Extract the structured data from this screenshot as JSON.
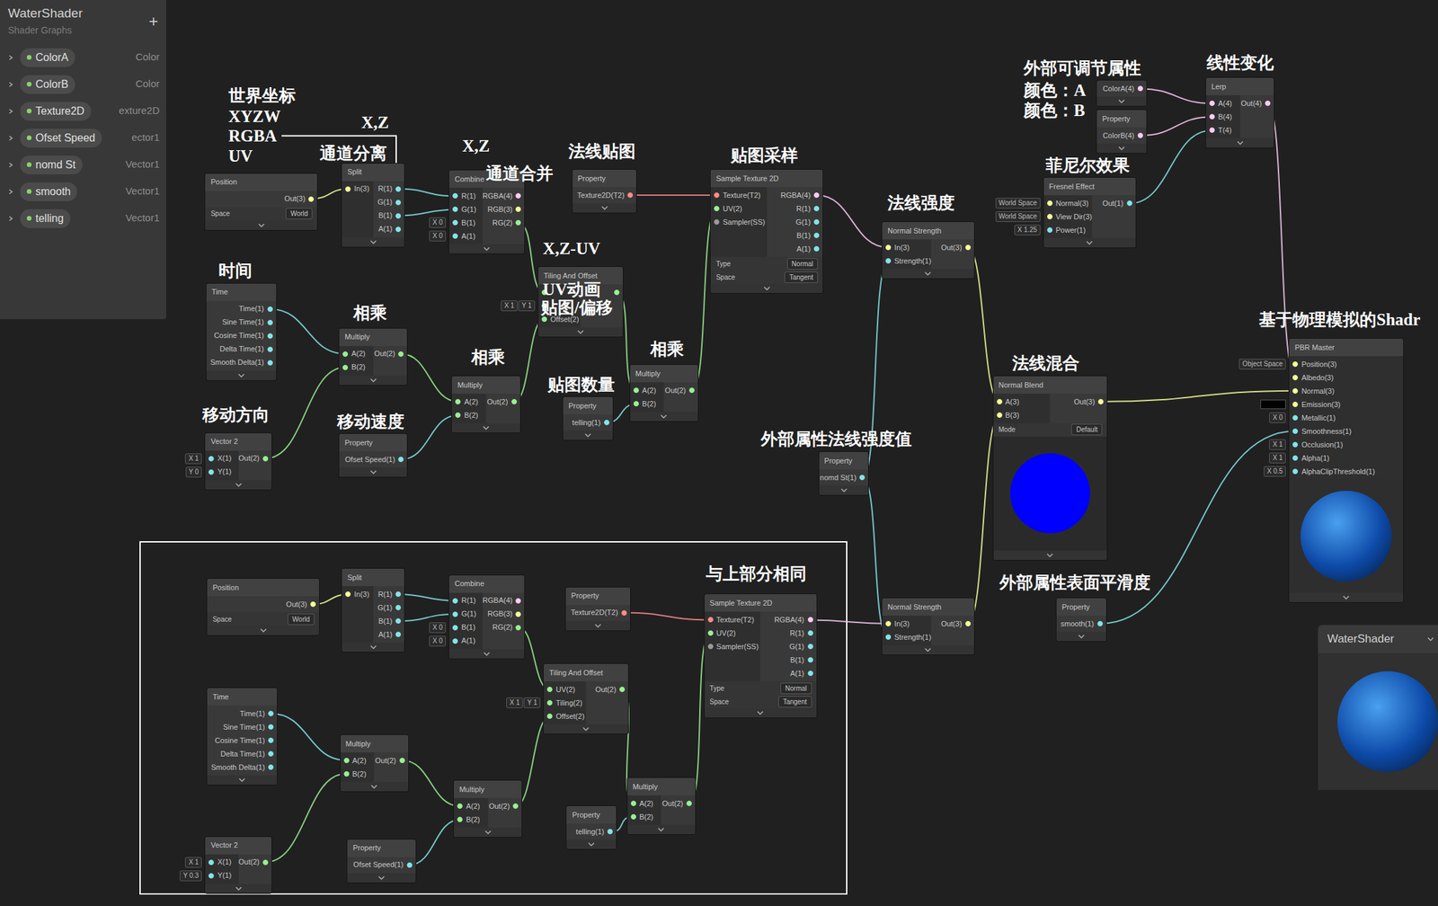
{
  "blackboard": {
    "title": "WaterShader",
    "subtitle": "Shader Graphs",
    "add": "+",
    "properties": [
      {
        "name": "ColorA",
        "type": "Color",
        "expanded": false
      },
      {
        "name": "ColorB",
        "type": "Color",
        "expanded": false
      },
      {
        "name": "Texture2D",
        "type": "exture2D",
        "expanded": false
      },
      {
        "name": "Ofset Speed",
        "type": "ector1",
        "expanded": false
      },
      {
        "name": "nomd St",
        "type": "Vector1",
        "expanded": false
      },
      {
        "name": "smooth",
        "type": "Vector1",
        "expanded": false
      },
      {
        "name": "telling",
        "type": "Vector1",
        "expanded": false
      }
    ]
  },
  "nodes": [
    {
      "title": "Position",
      "inputs": [],
      "outputs": [
        {
          "label": "Out(3)"
        }
      ],
      "fields": [
        {
          "label": "Space",
          "value": "World"
        }
      ]
    },
    {
      "title": "Split",
      "inputs": [
        {
          "label": "In(3)"
        }
      ],
      "outputs": [
        {
          "label": "R(1)"
        },
        {
          "label": "G(1)"
        },
        {
          "label": "B(1)"
        },
        {
          "label": "A(1)"
        }
      ],
      "fields": []
    },
    {
      "title": "Combine",
      "inputs": [
        {
          "label": "R(1)"
        },
        {
          "label": "G(1)"
        },
        {
          "label": "B(1)",
          "inline": [
            "X 0"
          ]
        },
        {
          "label": "A(1)",
          "inline": [
            "X 0"
          ]
        }
      ],
      "outputs": [
        {
          "label": "RGBA(4)"
        },
        {
          "label": "RGB(3)"
        },
        {
          "label": "RG(2)"
        }
      ],
      "fields": []
    },
    {
      "title": "Property",
      "inputs": [],
      "outputs": [
        {
          "label": "Texture2D(T2)"
        }
      ],
      "fields": []
    },
    {
      "title": "Sample Texture 2D",
      "inputs": [
        {
          "label": "Texture(T2)"
        },
        {
          "label": "UV(2)"
        },
        {
          "label": "Sampler(SS)"
        }
      ],
      "outputs": [
        {
          "label": "RGBA(4)"
        },
        {
          "label": "R(1)"
        },
        {
          "label": "G(1)"
        },
        {
          "label": "B(1)"
        },
        {
          "label": "A(1)"
        }
      ],
      "fields": [
        {
          "label": "Type",
          "value": "Normal"
        },
        {
          "label": "Space",
          "value": "Tangent"
        }
      ]
    },
    {
      "title": "Tiling And Offset",
      "inputs": [
        {
          "label": ""
        },
        {
          "label": "",
          "inline": [
            "X 1",
            "Y 1"
          ]
        },
        {
          "label": "Offset(2)"
        }
      ],
      "outputs": [
        {
          "label": ""
        }
      ],
      "fields": []
    },
    {
      "title": "Time",
      "inputs": [],
      "outputs": [
        {
          "label": "Time(1)"
        },
        {
          "label": "Sine Time(1)"
        },
        {
          "label": "Cosine Time(1)"
        },
        {
          "label": "Delta Time(1)"
        },
        {
          "label": "Smooth Delta(1)"
        }
      ],
      "fields": []
    },
    {
      "title": "Multiply",
      "inputs": [
        {
          "label": "A(2)"
        },
        {
          "label": "B(2)"
        }
      ],
      "outputs": [
        {
          "label": "Out(2)"
        }
      ],
      "fields": []
    },
    {
      "title": "Vector 2",
      "inputs": [
        {
          "label": "X(1)",
          "inline": [
            "X 1"
          ]
        },
        {
          "label": "Y(1)",
          "inline": [
            "Y 0"
          ]
        }
      ],
      "outputs": [
        {
          "label": "Out(2)"
        }
      ],
      "fields": []
    },
    {
      "title": "Property",
      "inputs": [],
      "outputs": [
        {
          "label": "Ofset Speed(1)"
        }
      ],
      "fields": []
    },
    {
      "title": "Multiply",
      "inputs": [
        {
          "label": "A(2)"
        },
        {
          "label": "B(2)"
        }
      ],
      "outputs": [
        {
          "label": "Out(2)"
        }
      ],
      "fields": []
    },
    {
      "title": "Property",
      "inputs": [],
      "outputs": [
        {
          "label": "telling(1)"
        }
      ],
      "fields": []
    },
    {
      "title": "Multiply",
      "inputs": [
        {
          "label": "A(2)"
        },
        {
          "label": "B(2)"
        }
      ],
      "outputs": [
        {
          "label": "Out(2)"
        }
      ],
      "fields": []
    },
    {
      "title": "Normal Strength",
      "inputs": [
        {
          "label": "In(3)"
        },
        {
          "label": "Strength(1)"
        }
      ],
      "outputs": [
        {
          "label": "Out(3)"
        }
      ],
      "fields": []
    },
    {
      "title": "Fresnel Effect",
      "inputs": [
        {
          "label": "Normal(3)",
          "inline": [
            "World Space"
          ]
        },
        {
          "label": "View Dir(3)",
          "inline": [
            "World Space"
          ]
        },
        {
          "label": "Power(1)",
          "inline": [
            "X 1.25"
          ]
        }
      ],
      "outputs": [
        {
          "label": "Out(1)"
        }
      ],
      "fields": []
    },
    {
      "inputs": [],
      "outputs": [
        {
          "label": "ColorA(4)"
        }
      ],
      "fields": []
    },
    {
      "title": "Property",
      "inputs": [],
      "outputs": [
        {
          "label": "ColorB(4)"
        }
      ],
      "fields": []
    },
    {
      "title": "Lerp",
      "inputs": [
        {
          "label": "A(4)"
        },
        {
          "label": "B(4)"
        },
        {
          "label": "T(4)"
        }
      ],
      "outputs": [
        {
          "label": "Out(4)"
        }
      ],
      "fields": []
    },
    {
      "title": "Property",
      "inputs": [],
      "outputs": [
        {
          "label": "nomd St(1)"
        }
      ],
      "fields": []
    },
    {
      "title": "Normal Blend",
      "inputs": [
        {
          "label": "A(3)"
        },
        {
          "label": "B(3)"
        }
      ],
      "outputs": [
        {
          "label": "Out(3)"
        }
      ],
      "fields": [
        {
          "label": "Mode",
          "value": "Default"
        }
      ],
      "preview": "circle"
    },
    {
      "title": "Normal Strength",
      "inputs": [
        {
          "label": "In(3)"
        },
        {
          "label": "Strength(1)"
        }
      ],
      "outputs": [
        {
          "label": "Out(3)"
        }
      ],
      "fields": []
    },
    {
      "title": "Property",
      "inputs": [],
      "outputs": [
        {
          "label": "smooth(1)"
        }
      ],
      "fields": []
    },
    {
      "title": "PBR Master",
      "inputs": [
        {
          "label": "Position(3)",
          "inline": [
            "Object Space"
          ]
        },
        {
          "label": "Albedo(3)"
        },
        {
          "label": "Normal(3)"
        },
        {
          "label": "Emission(3)",
          "swatch": "#000000"
        },
        {
          "label": "Metallic(1)",
          "inline": [
            "X 0"
          ]
        },
        {
          "label": "Smoothness(1)"
        },
        {
          "label": "Occlusion(1)",
          "inline": [
            "X 1"
          ]
        },
        {
          "label": "Alpha(1)",
          "inline": [
            "X 1"
          ]
        },
        {
          "label": "AlphaClipThreshold(1)",
          "inline": [
            "X 0.5"
          ]
        }
      ],
      "outputs": [],
      "fields": [],
      "preview": "sphere"
    },
    {
      "title": "Position",
      "inputs": [],
      "outputs": [
        {
          "label": "Out(3)"
        }
      ],
      "fields": [
        {
          "label": "Space",
          "value": "World"
        }
      ]
    },
    {
      "title": "Split",
      "inputs": [
        {
          "label": "In(3)"
        }
      ],
      "outputs": [
        {
          "label": "R(1)"
        },
        {
          "label": "G(1)"
        },
        {
          "label": "B(1)"
        },
        {
          "label": "A(1)"
        }
      ],
      "fields": []
    },
    {
      "title": "Combine",
      "inputs": [
        {
          "label": "R(1)"
        },
        {
          "label": "G(1)"
        },
        {
          "label": "B(1)",
          "inline": [
            "X 0"
          ]
        },
        {
          "label": "A(1)",
          "inline": [
            "X 0"
          ]
        }
      ],
      "outputs": [
        {
          "label": "RGBA(4)"
        },
        {
          "label": "RGB(3)"
        },
        {
          "label": "RG(2)"
        }
      ],
      "fields": []
    },
    {
      "title": "Property",
      "inputs": [],
      "outputs": [
        {
          "label": "Texture2D(T2)"
        }
      ],
      "fields": []
    },
    {
      "title": "Sample Texture 2D",
      "inputs": [
        {
          "label": "Texture(T2)"
        },
        {
          "label": "UV(2)"
        },
        {
          "label": "Sampler(SS)"
        }
      ],
      "outputs": [
        {
          "label": "RGBA(4)"
        },
        {
          "label": "R(1)"
        },
        {
          "label": "G(1)"
        },
        {
          "label": "B(1)"
        },
        {
          "label": "A(1)"
        }
      ],
      "fields": [
        {
          "label": "Type",
          "value": "Normal"
        },
        {
          "label": "Space",
          "value": "Tangent"
        }
      ]
    },
    {
      "title": "Time",
      "inputs": [],
      "outputs": [
        {
          "label": "Time(1)"
        },
        {
          "label": "Sine Time(1)"
        },
        {
          "label": "Cosine Time(1)"
        },
        {
          "label": "Delta Time(1)"
        },
        {
          "label": "Smooth Delta(1)"
        }
      ],
      "fields": []
    },
    {
      "title": "Multiply",
      "inputs": [
        {
          "label": "A(2)"
        },
        {
          "label": "B(2)"
        }
      ],
      "outputs": [
        {
          "label": "Out(2)"
        }
      ],
      "fields": []
    },
    {
      "title": "Tiling And Offset",
      "inputs": [
        {
          "label": "UV(2)"
        },
        {
          "label": "Tiling(2)",
          "inline": [
            "X 1",
            "Y 1"
          ]
        },
        {
          "label": "Offset(2)"
        }
      ],
      "outputs": [
        {
          "label": "Out(2)"
        }
      ],
      "fields": []
    },
    {
      "title": "Vector 2",
      "inputs": [
        {
          "label": "X(1)",
          "inline": [
            "X 1"
          ]
        },
        {
          "label": "Y(1)",
          "inline": [
            "Y 0.3"
          ]
        }
      ],
      "outputs": [
        {
          "label": "Out(2)"
        }
      ],
      "fields": []
    },
    {
      "title": "Multiply",
      "inputs": [
        {
          "label": "A(2)"
        },
        {
          "label": "B(2)"
        }
      ],
      "outputs": [
        {
          "label": "Out(2)"
        }
      ],
      "fields": []
    },
    {
      "title": "Property",
      "inputs": [],
      "outputs": [
        {
          "label": "Ofset Speed(1)"
        }
      ],
      "fields": []
    },
    {
      "title": "Property",
      "inputs": [],
      "outputs": [
        {
          "label": "telling(1)"
        }
      ],
      "fields": []
    },
    {
      "title": "Multiply",
      "inputs": [
        {
          "label": "A(2)"
        },
        {
          "label": "B(2)"
        }
      ],
      "outputs": [
        {
          "label": "Out(2)"
        }
      ],
      "fields": []
    }
  ],
  "annotations": [
    {
      "text": "世界坐标"
    },
    {
      "text": "XYZW"
    },
    {
      "text": "RGBA"
    },
    {
      "text": "UV"
    },
    {
      "text": "X,Z"
    },
    {
      "text": "通道分离"
    },
    {
      "text": "X,Z"
    },
    {
      "text": "通道合并"
    },
    {
      "text": "法线贴图"
    },
    {
      "text": "贴图采样"
    },
    {
      "text": "X,Z-UV"
    },
    {
      "text": "UV动画"
    },
    {
      "text": "贴图/偏移"
    },
    {
      "text": "时间"
    },
    {
      "text": "相乘"
    },
    {
      "text": "相乘"
    },
    {
      "text": "相乘"
    },
    {
      "text": "贴图数量"
    },
    {
      "text": "移动方向"
    },
    {
      "text": "移动速度"
    },
    {
      "text": "法线强度"
    },
    {
      "text": "外部可调节属性"
    },
    {
      "text": "颜色：A"
    },
    {
      "text": "颜色：B"
    },
    {
      "text": "线性变化"
    },
    {
      "text": "菲尼尔效果"
    },
    {
      "text": "法线混合"
    },
    {
      "text": "外部属性法线强度值"
    },
    {
      "text": "基于物理模拟的Shadr"
    },
    {
      "text": "与上部分相同"
    },
    {
      "text": "外部属性表面平滑度"
    }
  ],
  "preview_window": {
    "title": "WaterShader"
  }
}
